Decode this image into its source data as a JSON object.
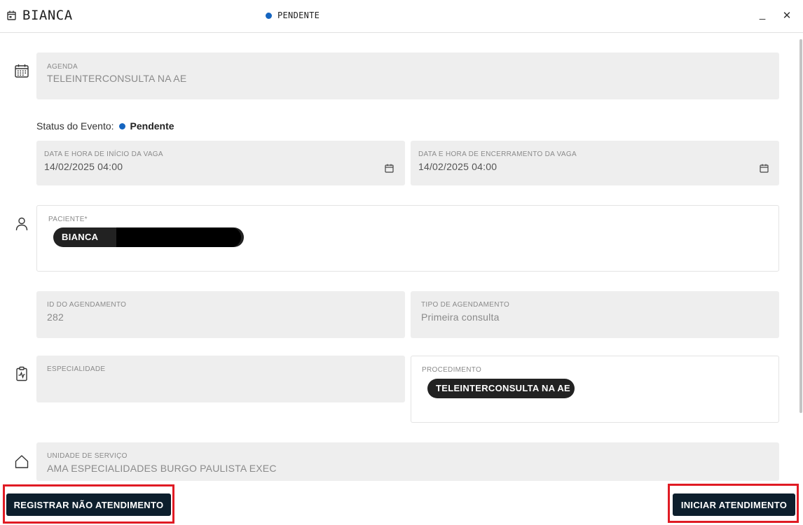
{
  "header": {
    "title": "BIANCA",
    "status": "PENDENTE",
    "minimize_glyph": "_",
    "close_glyph": "✕",
    "icon": "calendar-event-icon",
    "status_color": "#1565c0"
  },
  "agenda": {
    "label": "AGENDA",
    "value": "TELEINTERCONSULTA NA AE",
    "icon": "calendar-grid-icon"
  },
  "event_status": {
    "label": "Status do Evento:",
    "value": "Pendente"
  },
  "start": {
    "label": "DATA E HORA DE INÍCIO DA VAGA",
    "value": "14/02/2025 04:00"
  },
  "end": {
    "label": "DATA E HORA DE ENCERRAMENTO DA VAGA",
    "value": "14/02/2025 04:00"
  },
  "patient": {
    "label": "PACIENTE*",
    "chip": "BIANCA",
    "icon": "person-icon"
  },
  "schedule_id": {
    "label": "ID DO AGENDAMENTO",
    "value": "282"
  },
  "schedule_type": {
    "label": "TIPO DE AGENDAMENTO",
    "value": "Primeira consulta"
  },
  "specialty": {
    "label": "ESPECIALIDADE",
    "value": "",
    "icon": "clipboard-pulse-icon"
  },
  "procedure": {
    "label": "PROCEDIMENTO",
    "chip": "TELEINTERCONSULTA NA AE"
  },
  "service_unit": {
    "label": "UNIDADE DE SERVIÇO",
    "value": "AMA ESPECIALIDADES BURGO PAULISTA EXEC",
    "icon": "home-icon"
  },
  "footer": {
    "no_show_button": "REGISTRAR NÃO ATENDIMENTO",
    "start_button": "INICIAR ATENDIMENTO",
    "button_color": "#0d1f2d",
    "highlight_color": "#e01b24"
  }
}
